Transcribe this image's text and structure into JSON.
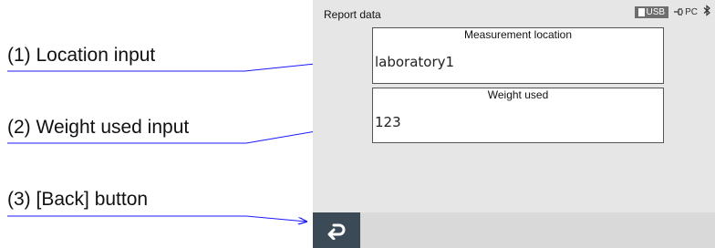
{
  "annotations": [
    {
      "label": "(1) Location input"
    },
    {
      "label": "(2) Weight used input"
    },
    {
      "label": "(3) [Back] button"
    }
  ],
  "screen": {
    "title": "Report data",
    "status": {
      "usb": "USB",
      "pc": "PC"
    },
    "fields": [
      {
        "header": "Measurement location",
        "value": "laboratory1"
      },
      {
        "header": "Weight used",
        "value": "123"
      }
    ],
    "back_icon": "return-arrow-icon"
  },
  "colors": {
    "screen_bg": "#e6e6e6",
    "back_button": "#3c4a57",
    "arrow": "#1a1aff"
  }
}
